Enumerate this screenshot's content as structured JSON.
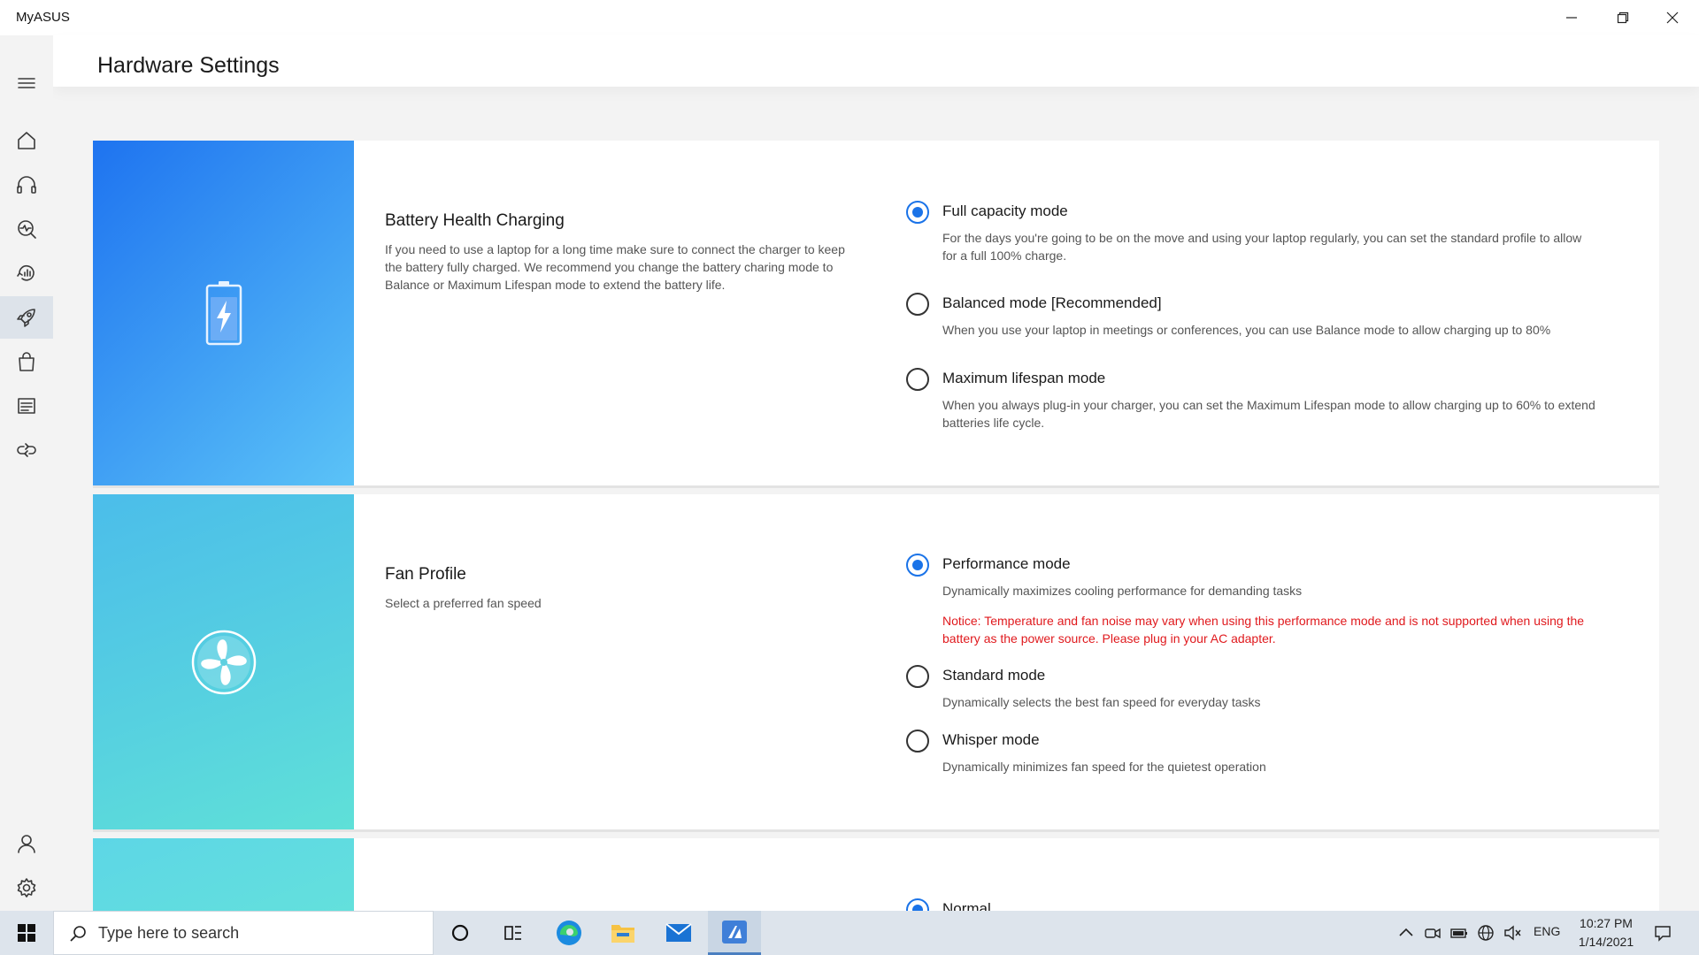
{
  "app": {
    "title": "MyASUS"
  },
  "page": {
    "title": "Hardware Settings"
  },
  "sidebar": {
    "items": [
      {
        "name": "home-icon"
      },
      {
        "name": "headset-icon"
      },
      {
        "name": "diagnosis-icon"
      },
      {
        "name": "system-analysis-icon"
      },
      {
        "name": "rocket-icon",
        "active": true
      },
      {
        "name": "shopping-bag-icon"
      },
      {
        "name": "article-icon"
      },
      {
        "name": "link-icon"
      }
    ],
    "bottom": [
      {
        "name": "user-icon"
      },
      {
        "name": "gear-icon"
      }
    ]
  },
  "battery": {
    "title": "Battery Health Charging",
    "description": "If you need to use a laptop for a long time make sure to connect the charger to keep the battery fully charged. We recommend you change the battery charing mode to Balance or Maximum Lifespan mode to extend the battery life.",
    "options": [
      {
        "label": "Full capacity mode",
        "checked": true,
        "desc": "For the days you're going to be on the move and using your laptop regularly, you can set the standard profile to allow for a full 100% charge."
      },
      {
        "label": "Balanced mode [Recommended]",
        "checked": false,
        "desc": "When you use your laptop in meetings or conferences, you can use Balance mode to allow charging up to 80%"
      },
      {
        "label": "Maximum lifespan mode",
        "checked": false,
        "desc": "When you always plug-in your charger, you can set the Maximum Lifespan mode to allow charging up to 60% to extend batteries life cycle."
      }
    ]
  },
  "fan": {
    "title": "Fan Profile",
    "description": "Select a preferred fan speed",
    "options": [
      {
        "label": "Performance mode",
        "checked": true,
        "desc": "Dynamically maximizes cooling performance for demanding tasks",
        "notice": "Notice: Temperature and fan noise may vary when using this performance mode and is not supported when using the battery as the power source. Please plug in your AC adapter."
      },
      {
        "label": "Standard mode",
        "checked": false,
        "desc": "Dynamically selects the best fan speed for everyday tasks"
      },
      {
        "label": "Whisper mode",
        "checked": false,
        "desc": "Dynamically minimizes fan speed for the quietest operation"
      }
    ]
  },
  "third": {
    "options": [
      {
        "label": "Normal",
        "checked": true
      }
    ]
  },
  "taskbar": {
    "search_placeholder": "Type here to search",
    "language": "ENG",
    "time": "10:27 PM",
    "date": "1/14/2021"
  },
  "colors": {
    "accent": "#1a73e8",
    "notice": "#e0191d",
    "battery_gradient": [
      "#1e73f0",
      "#5bc3f7"
    ],
    "fan_gradient": [
      "#4bbdea",
      "#5fe0d8"
    ],
    "third_gradient": [
      "#5dd6e6",
      "#63e0dc"
    ]
  }
}
